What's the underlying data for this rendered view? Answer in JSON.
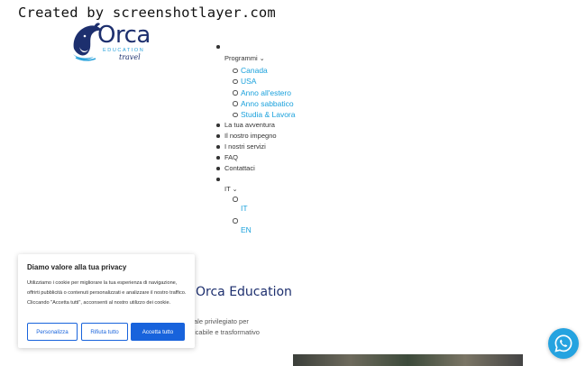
{
  "watermark": "Created by screenshotlayer.com",
  "logo": {
    "word": "Orca",
    "subtitle": "EDUCATION",
    "tagline": "travel",
    "icon": "orca-whale-icon",
    "colors": {
      "navy": "#1d2f6e",
      "blue": "#2ba3dc"
    }
  },
  "nav": {
    "programmi": "Programmi",
    "programmi_items": [
      "Canada",
      "USA",
      "Anno all'estero",
      "Anno sabbatico",
      "Studia & Lavora"
    ],
    "items": [
      "La tua avventura",
      "Il nostro impegno",
      "I nostri servizi",
      "FAQ",
      "Contattaci"
    ],
    "lang_current": "IT",
    "lang_options": [
      "IT",
      "EN"
    ]
  },
  "hero": {
    "title": "Orca Education",
    "line1": "ale privilegiato per",
    "line2": "icabile e trasformativo"
  },
  "cookie": {
    "title": "Diamo valore alla tua privacy",
    "text": "Utilizziamo i cookie per migliorare la tua esperienza di navigazione, offrirti pubblicità o contenuti personalizzati e analizzare il nostro traffico. Cliccando \"Accetta tutti\", acconsenti al nostro utilizzo dei cookie.",
    "customize": "Personalizza",
    "reject": "Rifiuta tutto",
    "accept": "Accetta tutto",
    "accent": "#1863dc"
  },
  "whatsapp": {
    "icon": "whatsapp-icon",
    "color": "#25a3e0"
  }
}
